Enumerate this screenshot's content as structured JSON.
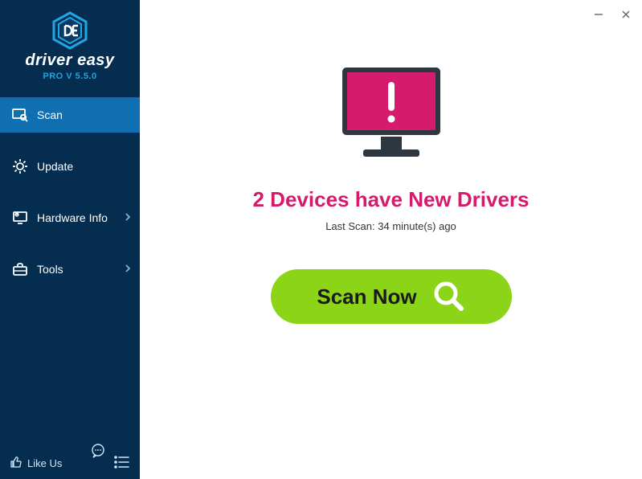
{
  "brand": "driver easy",
  "version": "PRO V 5.5.0",
  "nav": {
    "scan": "Scan",
    "update": "Update",
    "hardware": "Hardware Info",
    "tools": "Tools"
  },
  "like_us": "Like Us",
  "main": {
    "headline": "2 Devices have New Drivers",
    "last_scan": "Last Scan: 34 minute(s) ago",
    "scan_button": "Scan Now"
  }
}
